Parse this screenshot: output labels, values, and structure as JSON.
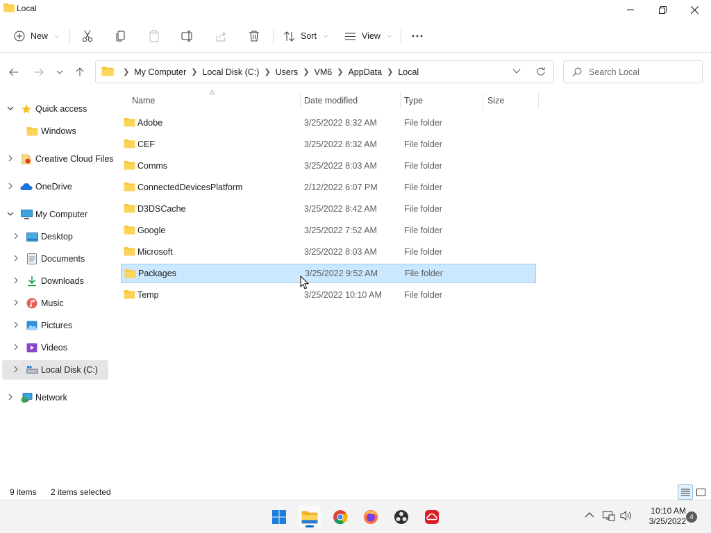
{
  "window": {
    "title": "Local",
    "controls": [
      "minimize",
      "maximize",
      "close"
    ]
  },
  "toolbar": {
    "new_label": "New",
    "sort_label": "Sort",
    "view_label": "View",
    "icons": [
      "cut-icon",
      "copy-icon",
      "paste-icon",
      "rename-icon",
      "share-icon",
      "delete-icon",
      "more-icon"
    ]
  },
  "address": {
    "breadcrumbs": [
      "My Computer",
      "Local Disk (C:)",
      "Users",
      "VM6",
      "AppData",
      "Local"
    ]
  },
  "search": {
    "placeholder": "Search Local"
  },
  "sidebar": {
    "items": [
      {
        "label": "Quick access",
        "icon": "star-icon",
        "expander": "expanded"
      },
      {
        "label": "Windows",
        "icon": "folder-icon",
        "expander": "none"
      },
      {
        "label": "Creative Cloud Files",
        "icon": "creative-cloud-icon",
        "expander": "collapsed"
      },
      {
        "label": "OneDrive",
        "icon": "onedrive-cloud-icon",
        "expander": "collapsed"
      },
      {
        "label": "My Computer",
        "icon": "computer-icon",
        "expander": "expanded"
      },
      {
        "label": "Desktop",
        "icon": "desktop-icon",
        "expander": "collapsed"
      },
      {
        "label": "Documents",
        "icon": "documents-icon",
        "expander": "collapsed"
      },
      {
        "label": "Downloads",
        "icon": "download-icon",
        "expander": "collapsed"
      },
      {
        "label": "Music",
        "icon": "music-icon",
        "expander": "collapsed"
      },
      {
        "label": "Pictures",
        "icon": "pictures-icon",
        "expander": "collapsed"
      },
      {
        "label": "Videos",
        "icon": "videos-icon",
        "expander": "collapsed"
      },
      {
        "label": "Local Disk (C:)",
        "icon": "drive-icon",
        "expander": "collapsed",
        "selected": true
      },
      {
        "label": "Network",
        "icon": "network-icon",
        "expander": "collapsed"
      }
    ]
  },
  "columns": {
    "name": "Name",
    "date": "Date modified",
    "type": "Type",
    "size": "Size"
  },
  "files": [
    {
      "name": "Adobe",
      "date": "3/25/2022 8:32 AM",
      "type": "File folder"
    },
    {
      "name": "CEF",
      "date": "3/25/2022 8:32 AM",
      "type": "File folder"
    },
    {
      "name": "Comms",
      "date": "3/25/2022 8:03 AM",
      "type": "File folder"
    },
    {
      "name": "ConnectedDevicesPlatform",
      "date": "2/12/2022 6:07 PM",
      "type": "File folder"
    },
    {
      "name": "D3DSCache",
      "date": "3/25/2022 8:42 AM",
      "type": "File folder"
    },
    {
      "name": "Google",
      "date": "3/25/2022 7:52 AM",
      "type": "File folder"
    },
    {
      "name": "Microsoft",
      "date": "3/25/2022 8:03 AM",
      "type": "File folder"
    },
    {
      "name": "Packages",
      "date": "3/25/2022 9:52 AM",
      "type": "File folder",
      "selected": true
    },
    {
      "name": "Temp",
      "date": "3/25/2022 10:10 AM",
      "type": "File folder"
    }
  ],
  "status": {
    "items_count": "9 items",
    "selection": "2 items selected"
  },
  "taskbar": {
    "apps": [
      "windows-start-icon",
      "file-explorer-icon",
      "chrome-icon",
      "firefox-icon",
      "obs-icon",
      "creative-cloud-icon"
    ],
    "time": "10:10 AM",
    "date": "3/25/2022",
    "notification_count": "4"
  },
  "colors": {
    "selection_bg": "#cce8ff",
    "selection_border": "#99d1ff",
    "folder_yellow": "#f8c93e",
    "accent": "#0067c0"
  }
}
